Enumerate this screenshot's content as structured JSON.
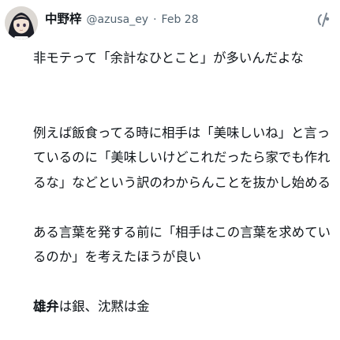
{
  "tweet": {
    "author_name": "中野梓",
    "handle": "@azusa_ey",
    "separator": "·",
    "date": "Feb 28",
    "brand_icon": "brand-logo-icon",
    "body": {
      "line1": "非モテって「余計なひとこと」が多いんだよな",
      "para2": "例えば飯食ってる時に相手は「美味しいね」と言っているのに「美味しいけどこれだったら家でも作れるな」などという訳のわからんことを抜かし始める",
      "para3": "ある言葉を発する前に「相手はこの言葉を求めているのか」を考えたほうが良い",
      "closing_bold": "雄弁",
      "closing_rest": "は銀、沈黙は金"
    }
  }
}
